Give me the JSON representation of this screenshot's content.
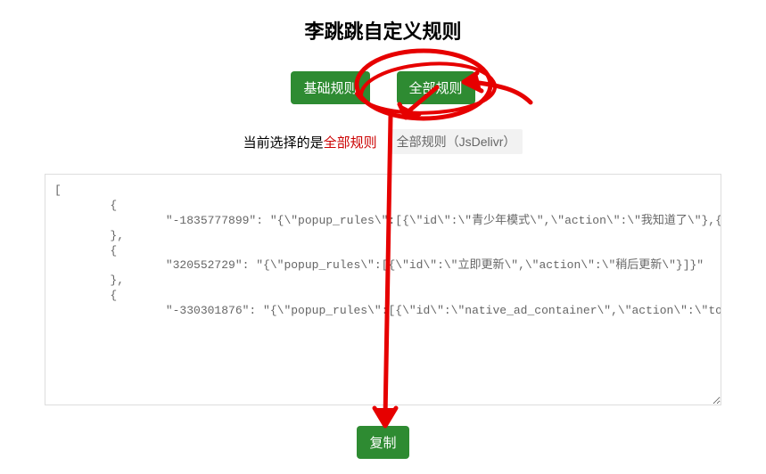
{
  "page_title": "李跳跳自定义规则",
  "buttons": {
    "basic": "基础规则",
    "all": "全部规则"
  },
  "current_selection": {
    "prefix": "当前选择的是",
    "value": "全部规则",
    "variant": "全部规则（JsDelivr）"
  },
  "rules_text": "[\n        {\n                \"-1835777899\": \"{\\\"popup_rules\\\":[{\\\"id\\\":\\\"青少年模式\\\",\\\"action\\\":\\\"我知道了\\\"},{\\\"id\\\":\\\"common_confirm_dialog_center_layout\\\",\\\"action\\\":\\\"common_confirm_dialog_cancel\\\"},{\\\"id\\\":\\\"打开定位\\\",\\\"action\\\":\\\"我知道了\\\"},{\\\"id\\\":\\\"及时获取&消息\\\",\\\"action\\\":\\\"取消\\\"},{\\\"id\\\":\\\"tv_love_sub_title\\\",\\\"action\\\":\\\"iv_close_love_tips\\\"},{\\\"id\\\":\\\"打开通知\\\",\\\"action\\\":\\\"iv_notice_close\\\"}]}\"\n        },\n        {\n                \"320552729\": \"{\\\"popup_rules\\\":[{\\\"id\\\":\\\"立即更新\\\",\\\"action\\\":\\\"稍后更新\\\"}]}\"\n        },\n        {\n                \"-330301876\": \"{\\\"popup_rules\\\":[{\\\"id\\\":\\\"native_ad_container\\\",\\\"action\\\":\\\"topon_btn_close\\\"},{\\\"id\\\":\\\"csj_ad_logo\\\",\\\"action\\\":\\\"csj_btn_close\\\"},{\\\"id\\\":\\\"| 跳过\\\",\\\"action\\\":\\\"| 跳过\\\"},{\\\"id\\\":\\\"再看&可领奖励\\\",\\\"action\\\":\\\"坚持退出\\\"}],\\\"click way popup\\\":1}\"",
  "copy_button": "复制"
}
